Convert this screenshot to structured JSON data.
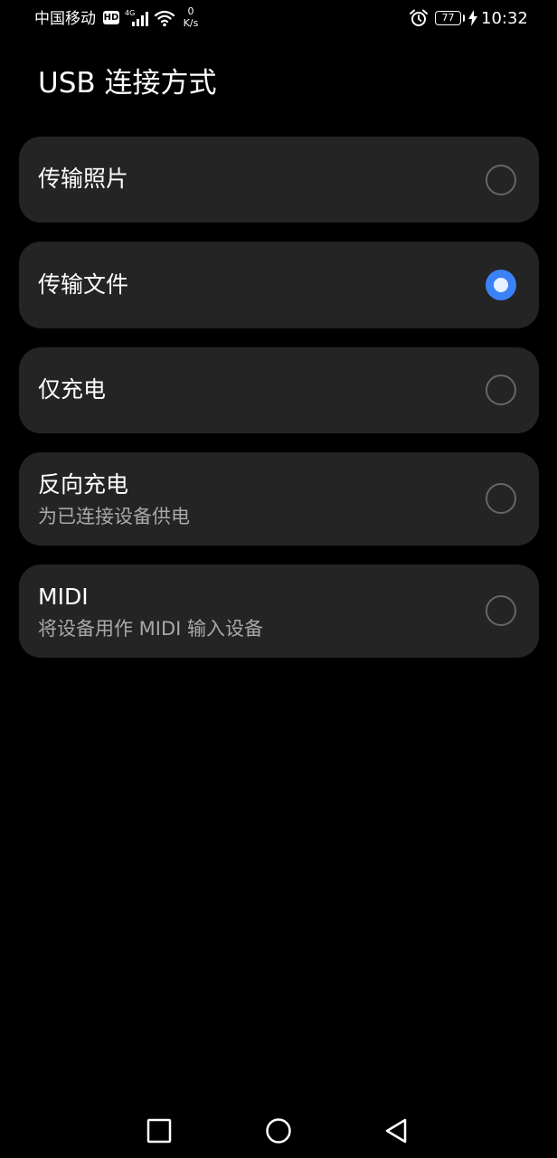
{
  "status_bar": {
    "carrier": "中国移动",
    "hd_badge": "HD",
    "network_type": "4G",
    "speed_value": "0",
    "speed_unit": "K/s",
    "battery_level": "77",
    "time": "10:32"
  },
  "page": {
    "title": "USB 连接方式"
  },
  "options": [
    {
      "label": "传输照片",
      "sublabel": "",
      "selected": false
    },
    {
      "label": "传输文件",
      "sublabel": "",
      "selected": true
    },
    {
      "label": "仅充电",
      "sublabel": "",
      "selected": false
    },
    {
      "label": "反向充电",
      "sublabel": "为已连接设备供电",
      "selected": false
    },
    {
      "label": "MIDI",
      "sublabel": "将设备用作 MIDI 输入设备",
      "selected": false
    }
  ],
  "colors": {
    "accent": "#3b82f6",
    "card_background": "#242424",
    "background": "#000000"
  },
  "icons": {
    "nav_recents": "square-icon",
    "nav_home": "circle-icon",
    "nav_back": "triangle-back-icon"
  }
}
